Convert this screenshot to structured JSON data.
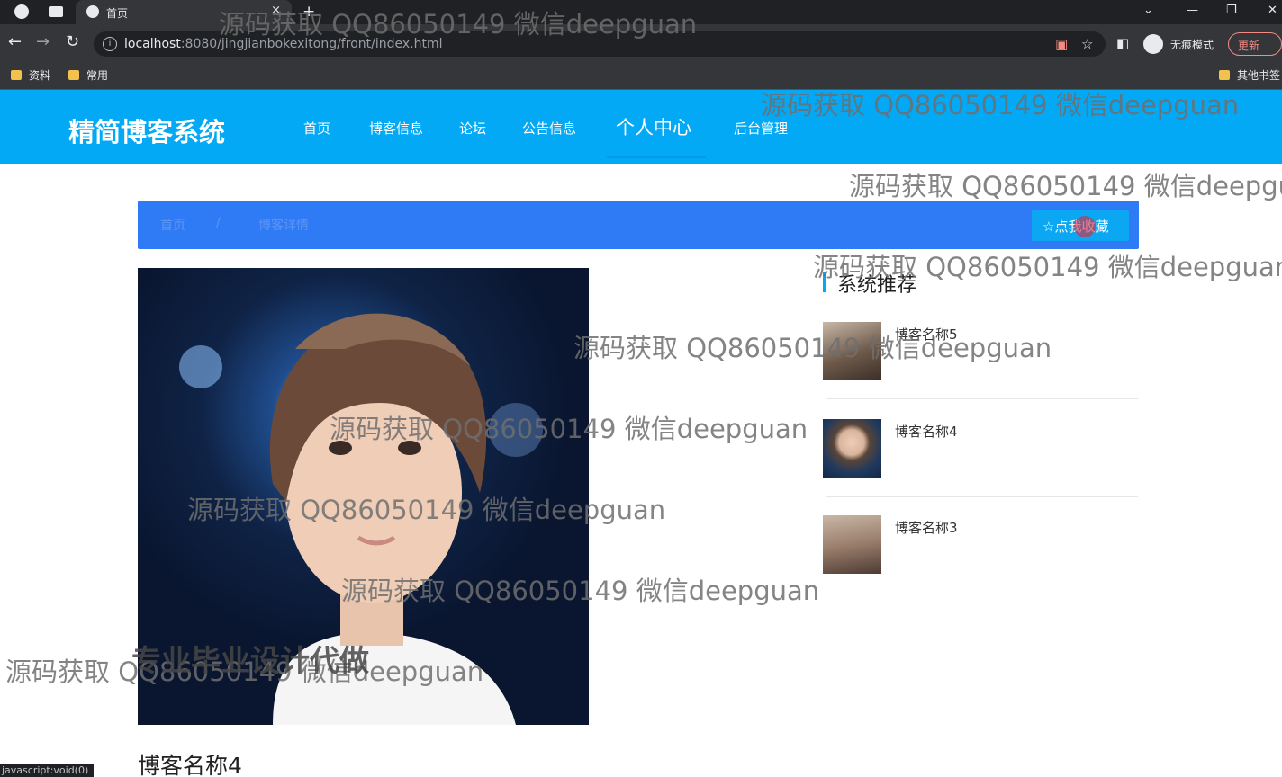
{
  "browser": {
    "tab_title": "首页",
    "tab_close": "×",
    "new_tab": "+",
    "url_host": "localhost",
    "url_rest": ":8080/jingjianbokexitong/front/index.html",
    "incognito_label": "无痕模式",
    "update_label": "更新",
    "bookmarks": [
      "资料",
      "常用"
    ],
    "other_bookmarks": "其他书签",
    "status_text": "javascript:void(0)"
  },
  "site": {
    "logo": "精简博客系统",
    "nav": [
      "首页",
      "博客信息",
      "论坛",
      "公告信息",
      "个人中心",
      "后台管理"
    ],
    "active_nav": "个人中心",
    "accent_color": "#03a9f4"
  },
  "breadcrumb": {
    "home": "首页",
    "separator": "/",
    "current": "博客详情",
    "favorite_button": "☆点我收藏"
  },
  "detail": {
    "title": "博客名称4"
  },
  "recommend": {
    "title": "系统推荐",
    "items": [
      {
        "name": "博客名称5"
      },
      {
        "name": "博客名称4"
      },
      {
        "name": "博客名称3"
      }
    ]
  },
  "overlay": {
    "watermark": "源码获取 QQ86050149 微信deepguan",
    "promo": "专业毕业设计代做"
  }
}
